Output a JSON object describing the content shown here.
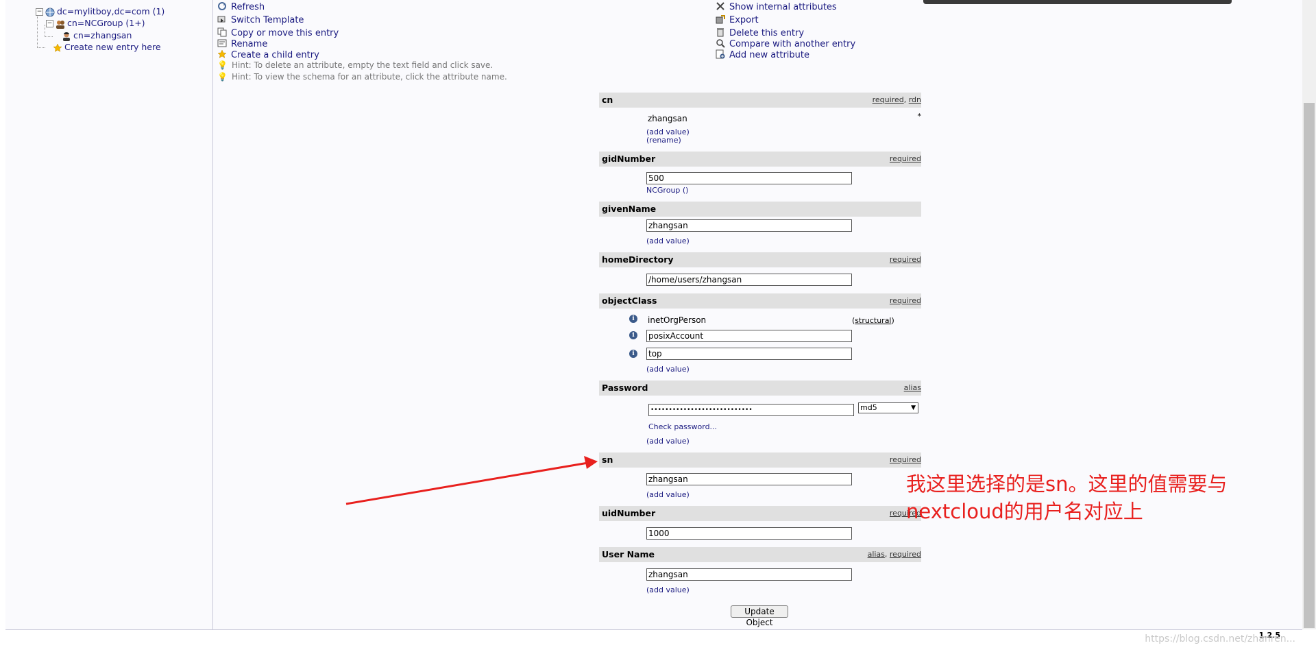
{
  "tree": {
    "root": "dc=mylitboy,dc=com (1)",
    "group": "cn=NCGroup (1+)",
    "user": "cn=zhangsan",
    "create": "Create new entry here"
  },
  "menu": {
    "left": [
      "Refresh",
      "Switch Template",
      "Copy or move this entry",
      "Rename",
      "Create a child entry"
    ],
    "right": [
      "Show internal attributes",
      "Export",
      "Delete this entry",
      "Compare with another entry",
      "Add new attribute"
    ],
    "hints": [
      "Hint: To delete an attribute, empty the text field and click save.",
      "Hint: To view the schema for an attribute, click the attribute name."
    ]
  },
  "attributes": {
    "cn": {
      "name": "cn",
      "flag1": "required",
      "flag2": "rdn",
      "value": "zhangsan",
      "add": "(add value)",
      "rename": "(rename)"
    },
    "gidNumber": {
      "name": "gidNumber",
      "flag": "required",
      "value": "500",
      "note": "NCGroup ()"
    },
    "givenName": {
      "name": "givenName",
      "value": "zhangsan",
      "add": "(add value)"
    },
    "homeDirectory": {
      "name": "homeDirectory",
      "flag": "required",
      "value": "/home/users/zhangsan"
    },
    "objectClass": {
      "name": "objectClass",
      "flag": "required",
      "values": [
        "inetOrgPerson",
        "posixAccount",
        "top"
      ],
      "structural": "structural",
      "add": "(add value)"
    },
    "password": {
      "name": "Password",
      "flag": "alias",
      "value": "••••••••••••••••••••••••••••",
      "hash": "md5",
      "check": "Check password...",
      "add": "(add value)"
    },
    "sn": {
      "name": "sn",
      "flag": "required",
      "value": "zhangsan",
      "add": "(add value)"
    },
    "uidNumber": {
      "name": "uidNumber",
      "flag": "required",
      "value": "1000"
    },
    "userName": {
      "name": "User Name",
      "flag1": "alias",
      "flag2": "required",
      "value": "zhangsan",
      "add": "(add value)"
    }
  },
  "update_button": "Update Object",
  "version": "1.2.5",
  "annotation": {
    "line1": "我这里选择的是sn。这里的值需要与",
    "line2": "nextcloud的用户名对应上",
    "color": "#e8201e"
  },
  "watermark": "https://blog.csdn.net/zhanren..."
}
